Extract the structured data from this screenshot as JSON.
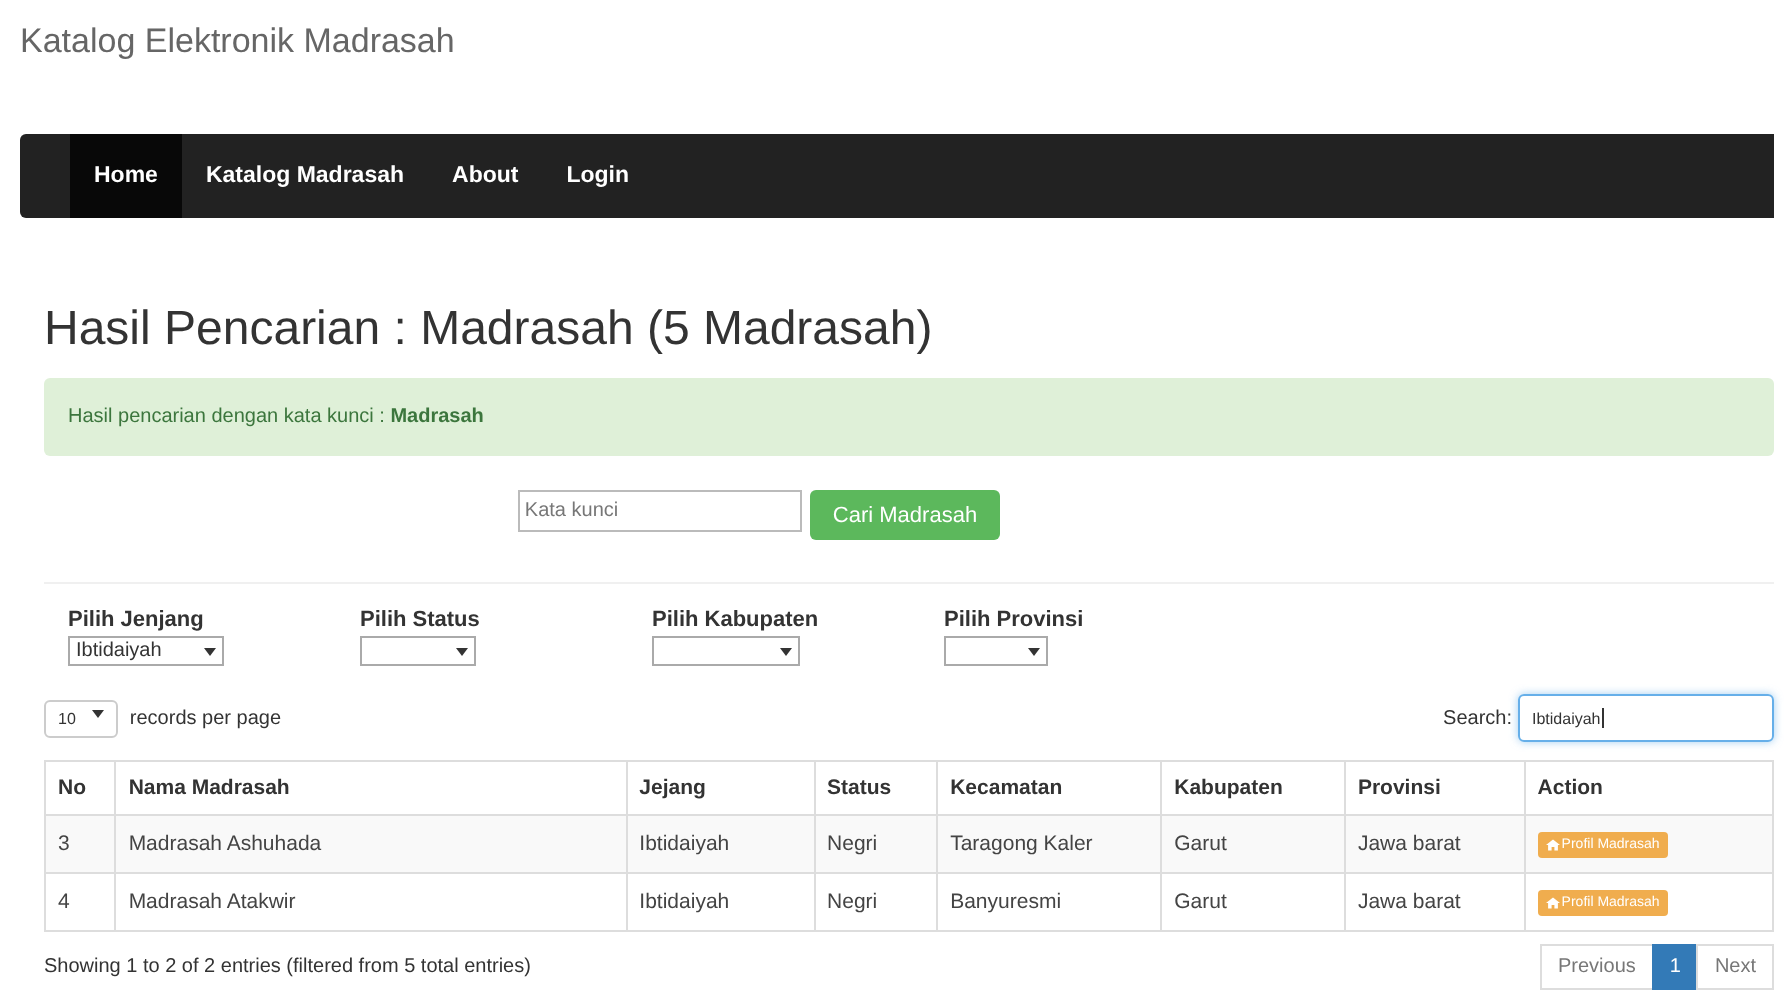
{
  "site_title": "Katalog Elektronik Madrasah",
  "nav": [
    {
      "label": "Home",
      "selected": true
    },
    {
      "label": "Katalog Madrasah",
      "selected": false
    },
    {
      "label": "About",
      "selected": false
    },
    {
      "label": "Login",
      "selected": false
    }
  ],
  "heading": "Hasil Pencarian : Madrasah (5 Madrasah)",
  "alert": "Hasil pencarian dengan kata kunci : **Madrasah**",
  "keyword_search": {
    "placeholder": "Kata kunci",
    "button": "Cari Madrasah"
  },
  "filters": [
    {
      "label": "Pilih Jenjang",
      "value": "Ibtidaiyah"
    },
    {
      "label": "Pilih Status"
    },
    {
      "label": "Pilih Kabupaten"
    },
    {
      "label": "Pilih Provinsi"
    }
  ],
  "page_length": {
    "value": "10",
    "label": "records per page"
  },
  "table_search": {
    "label": "Search:",
    "value": "Ibtidaiyah"
  },
  "table": {
    "columns": [
      "No",
      "Nama Madrasah",
      "Jejang",
      "Status",
      "Kecamatan",
      "Kabupaten",
      "Provinsi",
      "Action"
    ],
    "rows": [
      {
        "cells": [
          "3",
          "Madrasah Ashuhada",
          "Ibtidaiyah",
          "Negri",
          "Taragong Kaler",
          "Garut",
          "Jawa barat"
        ],
        "action": "Profil Madrasah"
      },
      {
        "cells": [
          "4",
          "Madrasah Atakwir",
          "Ibtidaiyah",
          "Negri",
          "Banyuresmi",
          "Garut",
          "Jawa barat"
        ],
        "action": "Profil Madrasah"
      }
    ]
  },
  "info": "Showing 1 to 2 of 2 entries (filtered from 5 total entries)",
  "pagination": [
    {
      "label": "Previous",
      "selected": false
    },
    {
      "label": "1",
      "selected": true
    },
    {
      "label": "Next",
      "selected": false
    }
  ]
}
